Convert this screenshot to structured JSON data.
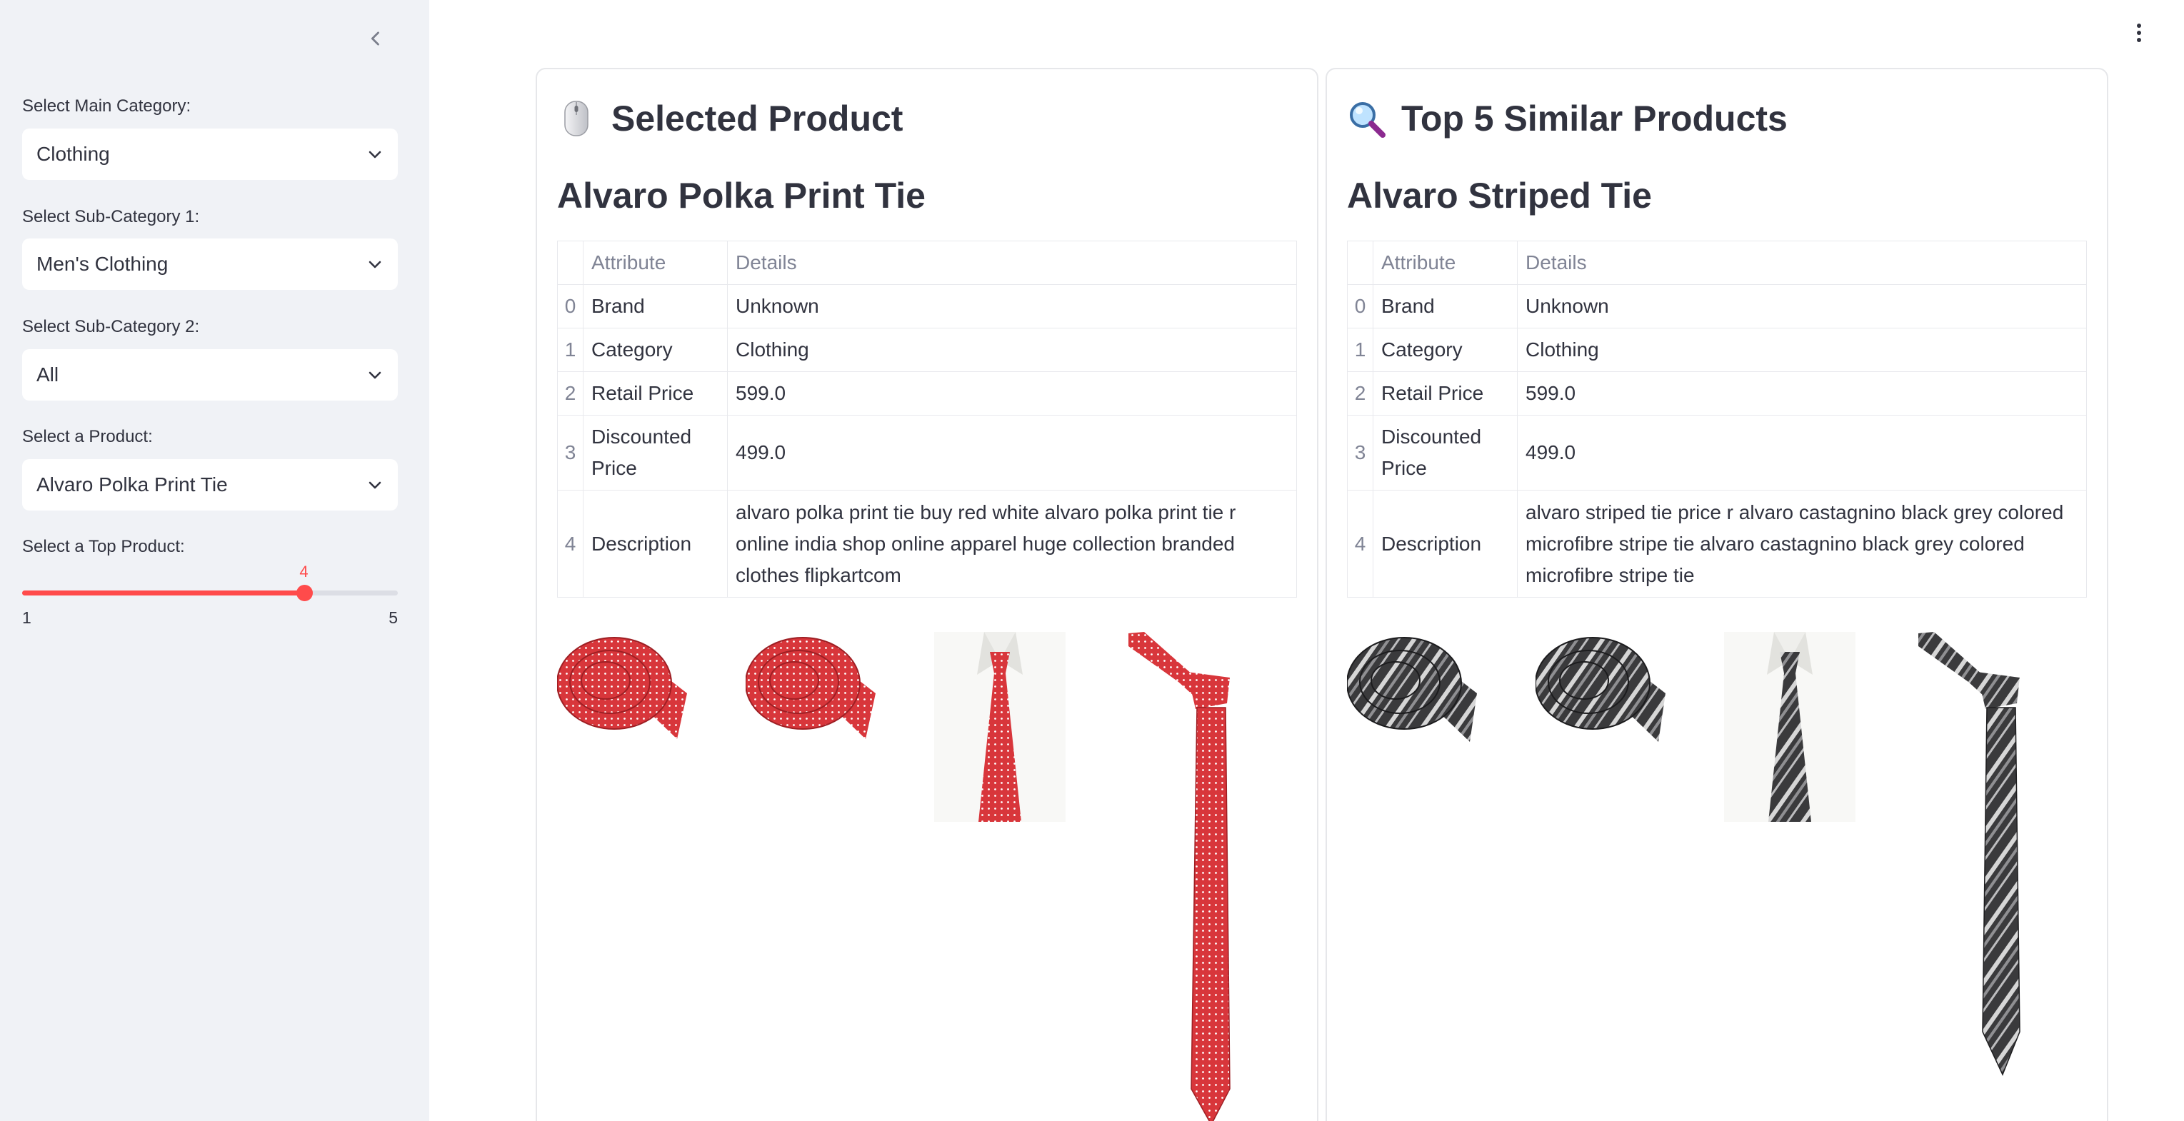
{
  "sidebar": {
    "main_category": {
      "label": "Select Main Category:",
      "value": "Clothing"
    },
    "sub_category_1": {
      "label": "Select Sub-Category 1:",
      "value": "Men's Clothing"
    },
    "sub_category_2": {
      "label": "Select Sub-Category 2:",
      "value": "All"
    },
    "product": {
      "label": "Select a Product:",
      "value": "Alvaro Polka Print Tie"
    },
    "top_product": {
      "label": "Select a Top Product:",
      "value": 4,
      "min": 1,
      "max": 5,
      "value_text": "4",
      "min_text": "1",
      "max_text": "5"
    }
  },
  "selected": {
    "header": "Selected Product",
    "icon": "computer-mouse-icon",
    "title": "Alvaro Polka Print Tie",
    "table": {
      "headers": [
        "Attribute",
        "Details"
      ],
      "rows": [
        {
          "idx": "0",
          "attr": "Brand",
          "details": "Unknown"
        },
        {
          "idx": "1",
          "attr": "Category",
          "details": "Clothing"
        },
        {
          "idx": "2",
          "attr": "Retail Price",
          "details": "599.0"
        },
        {
          "idx": "3",
          "attr": "Discounted Price",
          "details": "499.0"
        },
        {
          "idx": "4",
          "attr": "Description",
          "details": "alvaro polka print tie buy red white alvaro polka print tie r online india shop online apparel huge collection branded clothes flipkartcom"
        }
      ]
    }
  },
  "similar": {
    "header": "Top 5 Similar Products",
    "icon": "magnifying-glass-icon",
    "title": "Alvaro Striped Tie",
    "table": {
      "headers": [
        "Attribute",
        "Details"
      ],
      "rows": [
        {
          "idx": "0",
          "attr": "Brand",
          "details": "Unknown"
        },
        {
          "idx": "1",
          "attr": "Category",
          "details": "Clothing"
        },
        {
          "idx": "2",
          "attr": "Retail Price",
          "details": "599.0"
        },
        {
          "idx": "3",
          "attr": "Discounted Price",
          "details": "499.0"
        },
        {
          "idx": "4",
          "attr": "Description",
          "details": "alvaro striped tie price r alvaro castagnino black grey colored microfibre stripe tie alvaro castagnino black grey colored microfibre stripe tie"
        }
      ]
    }
  },
  "colors": {
    "accent": "#ff4b4b",
    "sidebar_bg": "#f0f2f6",
    "text": "#31333f",
    "muted": "#808495",
    "tie_red": "#d8363b",
    "tie_dark": "#3a3a3c"
  },
  "icons": {
    "collapse": "chevron-left-icon",
    "select_arrow": "chevron-down-icon",
    "menu": "kebab-menu-icon"
  }
}
